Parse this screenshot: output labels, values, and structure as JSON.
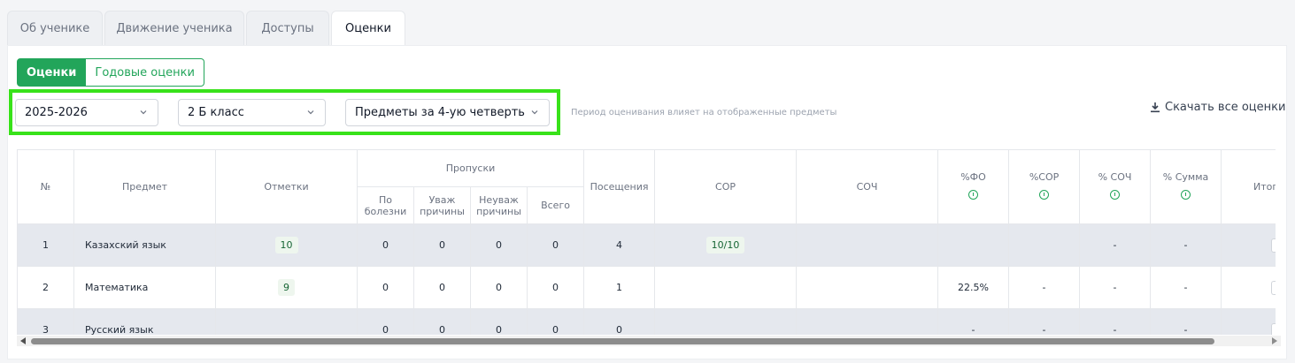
{
  "tabs": [
    {
      "label": "Об ученике",
      "active": false
    },
    {
      "label": "Движение ученика",
      "active": false
    },
    {
      "label": "Доступы",
      "active": false
    },
    {
      "label": "Оценки",
      "active": true
    }
  ],
  "subtabs": {
    "active": "Оценки",
    "other": "Годовые оценки"
  },
  "filters": {
    "year": "2025-2026",
    "class": "2 Б класс",
    "subjects": "Предметы за 4-ую четверть",
    "hint": "Период оценивания влияет на отображенные предметы"
  },
  "download_label": "Скачать все оценки",
  "table": {
    "headers": {
      "num": "№",
      "subject": "Предмет",
      "marks": "Отметки",
      "absences": "Пропуски",
      "abs_sick": "По болезни",
      "abs_valid": "Уваж причины",
      "abs_invalid": "Неуваж причины",
      "abs_total": "Всего",
      "attendance": "Посещения",
      "sor": "СОР",
      "soch": "СОЧ",
      "pct_fo": "%ФО",
      "pct_sor": "%СОР",
      "pct_soch": "% СОЧ",
      "pct_sum": "% Сумма",
      "final": "Итогова"
    },
    "rows": [
      {
        "num": "1",
        "subject": "Казахский язык",
        "marks": "10",
        "sick": "0",
        "valid": "0",
        "invalid": "0",
        "total": "0",
        "attendance": "4",
        "sor": "10/10",
        "soch": "",
        "pct_fo": "",
        "pct_sor": "",
        "pct_soch": "-",
        "pct_sum": "-"
      },
      {
        "num": "2",
        "subject": "Математика",
        "marks": "9",
        "sick": "0",
        "valid": "0",
        "invalid": "0",
        "total": "0",
        "attendance": "1",
        "sor": "",
        "soch": "",
        "pct_fo": "22.5%",
        "pct_sor": "-",
        "pct_soch": "-",
        "pct_sum": "-"
      },
      {
        "num": "3",
        "subject": "Русский язык",
        "marks": "",
        "sick": "0",
        "valid": "0",
        "invalid": "0",
        "total": "0",
        "attendance": "0",
        "sor": "",
        "soch": "",
        "pct_fo": "-",
        "pct_sor": "-",
        "pct_soch": "-",
        "pct_sum": "-"
      }
    ]
  },
  "colors": {
    "accent": "#22a55a",
    "highlight": "#38e21a",
    "row_shade": "#e5e8ee"
  }
}
